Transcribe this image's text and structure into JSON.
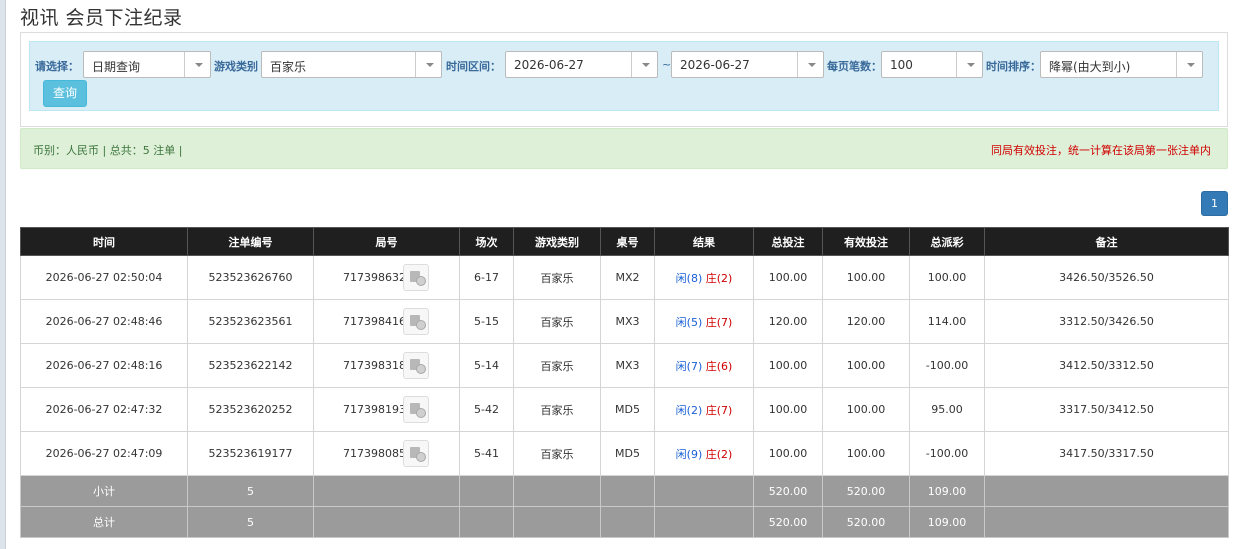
{
  "page": {
    "title": "视讯 会员下注纪录"
  },
  "filters": {
    "select_label": "请选择：",
    "select_value": "日期查询",
    "game_type_label": "游戏类别",
    "game_type_value": "百家乐",
    "time_range_label": "时间区间：",
    "date_from": "2026-06-27",
    "separator": "~",
    "date_to": "2026-06-27",
    "per_page_label": "每页笔数：",
    "per_page_value": "100",
    "sort_label": "时间排序：",
    "sort_value": "降幂(由大到小)",
    "query_button": "查询"
  },
  "info": {
    "left": "币别：人民币 | 总共：5 注单 |",
    "right": "同局有效投注，统一计算在该局第一张注单内"
  },
  "pagination": {
    "current": "1"
  },
  "table": {
    "headers": [
      "时间",
      "注单编号",
      "局号",
      "场次",
      "游戏类别",
      "桌号",
      "结果",
      "总投注",
      "有效投注",
      "总派彩",
      "备注"
    ],
    "rows": [
      {
        "time": "2026-06-27 02:50:04",
        "bet_id": "523523626760",
        "round": "717398632",
        "session": "6-17",
        "game": "百家乐",
        "table": "MX2",
        "player": "闲(8)",
        "banker": "庄(2)",
        "total_bet": "100.00",
        "valid_bet": "100.00",
        "payout": "100.00",
        "payout_negative": false,
        "remark": "3426.50/3526.50"
      },
      {
        "time": "2026-06-27 02:48:46",
        "bet_id": "523523623561",
        "round": "717398416",
        "session": "5-15",
        "game": "百家乐",
        "table": "MX3",
        "player": "闲(5)",
        "banker": "庄(7)",
        "total_bet": "120.00",
        "valid_bet": "120.00",
        "payout": "114.00",
        "payout_negative": false,
        "remark": "3312.50/3426.50"
      },
      {
        "time": "2026-06-27 02:48:16",
        "bet_id": "523523622142",
        "round": "717398318",
        "session": "5-14",
        "game": "百家乐",
        "table": "MX3",
        "player": "闲(7)",
        "banker": "庄(6)",
        "total_bet": "100.00",
        "valid_bet": "100.00",
        "payout": "-100.00",
        "payout_negative": true,
        "remark": "3412.50/3312.50"
      },
      {
        "time": "2026-06-27 02:47:32",
        "bet_id": "523523620252",
        "round": "717398193",
        "session": "5-42",
        "game": "百家乐",
        "table": "MD5",
        "player": "闲(2)",
        "banker": "庄(7)",
        "total_bet": "100.00",
        "valid_bet": "100.00",
        "payout": "95.00",
        "payout_negative": false,
        "remark": "3317.50/3412.50"
      },
      {
        "time": "2026-06-27 02:47:09",
        "bet_id": "523523619177",
        "round": "717398085",
        "session": "5-41",
        "game": "百家乐",
        "table": "MD5",
        "player": "闲(9)",
        "banker": "庄(2)",
        "total_bet": "100.00",
        "valid_bet": "100.00",
        "payout": "-100.00",
        "payout_negative": true,
        "remark": "3417.50/3317.50"
      }
    ],
    "subtotal": {
      "label": "小计",
      "count": "5",
      "total_bet": "520.00",
      "valid_bet": "520.00",
      "payout": "109.00"
    },
    "grandtotal": {
      "label": "总计",
      "count": "5",
      "total_bet": "520.00",
      "valid_bet": "520.00",
      "payout": "109.00"
    }
  },
  "colors": {
    "header_bg": "#1f1f1f",
    "total_bg": "#9b9b9b",
    "positive_blue": "#1a5fd6",
    "negative_red": "#d00000",
    "filter_bg": "#d9edf7",
    "info_bg": "#dff0d8"
  },
  "icons": {
    "replay": "video-replay-icon",
    "dropdown": "chevron-down-icon"
  }
}
